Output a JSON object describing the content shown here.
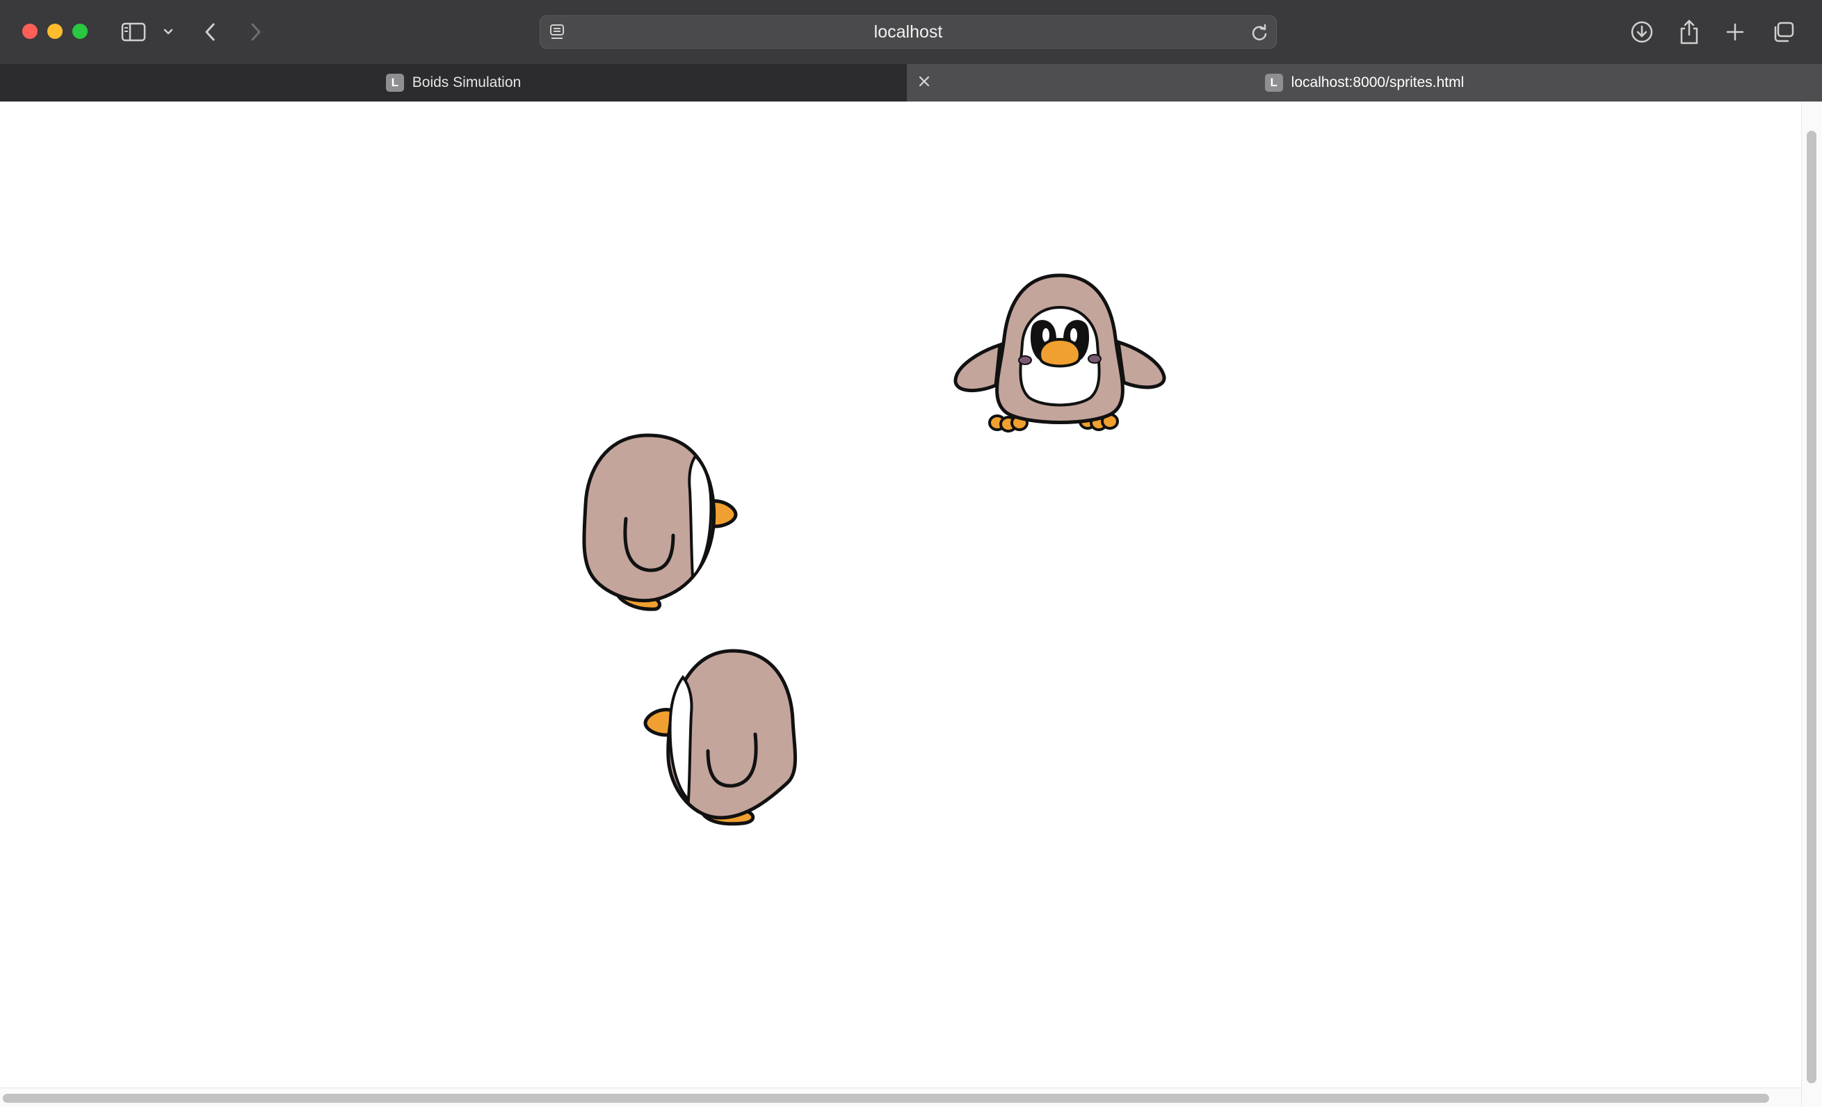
{
  "browser": {
    "address_text": "localhost",
    "icons": {
      "sidebar": "sidebar-icon",
      "sidebar_menu": "chevron-down-icon",
      "back": "chevron-left-icon",
      "forward": "chevron-right-icon",
      "reader": "reader-mode-icon",
      "reload": "reload-icon",
      "downloads": "download-icon",
      "share": "share-icon",
      "new_tab": "plus-icon",
      "tab_overview": "tab-overview-icon"
    }
  },
  "tabs": [
    {
      "favicon_letter": "L",
      "title": "Boids Simulation",
      "active": false
    },
    {
      "favicon_letter": "L",
      "title": "localhost:8000/sprites.html",
      "active": true
    }
  ],
  "page": {
    "sprites": [
      {
        "kind": "penguin-front"
      },
      {
        "kind": "penguin-side-right"
      },
      {
        "kind": "penguin-side-left"
      }
    ],
    "colors": {
      "penguin_body": "#c4a59c",
      "penguin_feet": "#f0a030",
      "outline": "#111111"
    }
  }
}
